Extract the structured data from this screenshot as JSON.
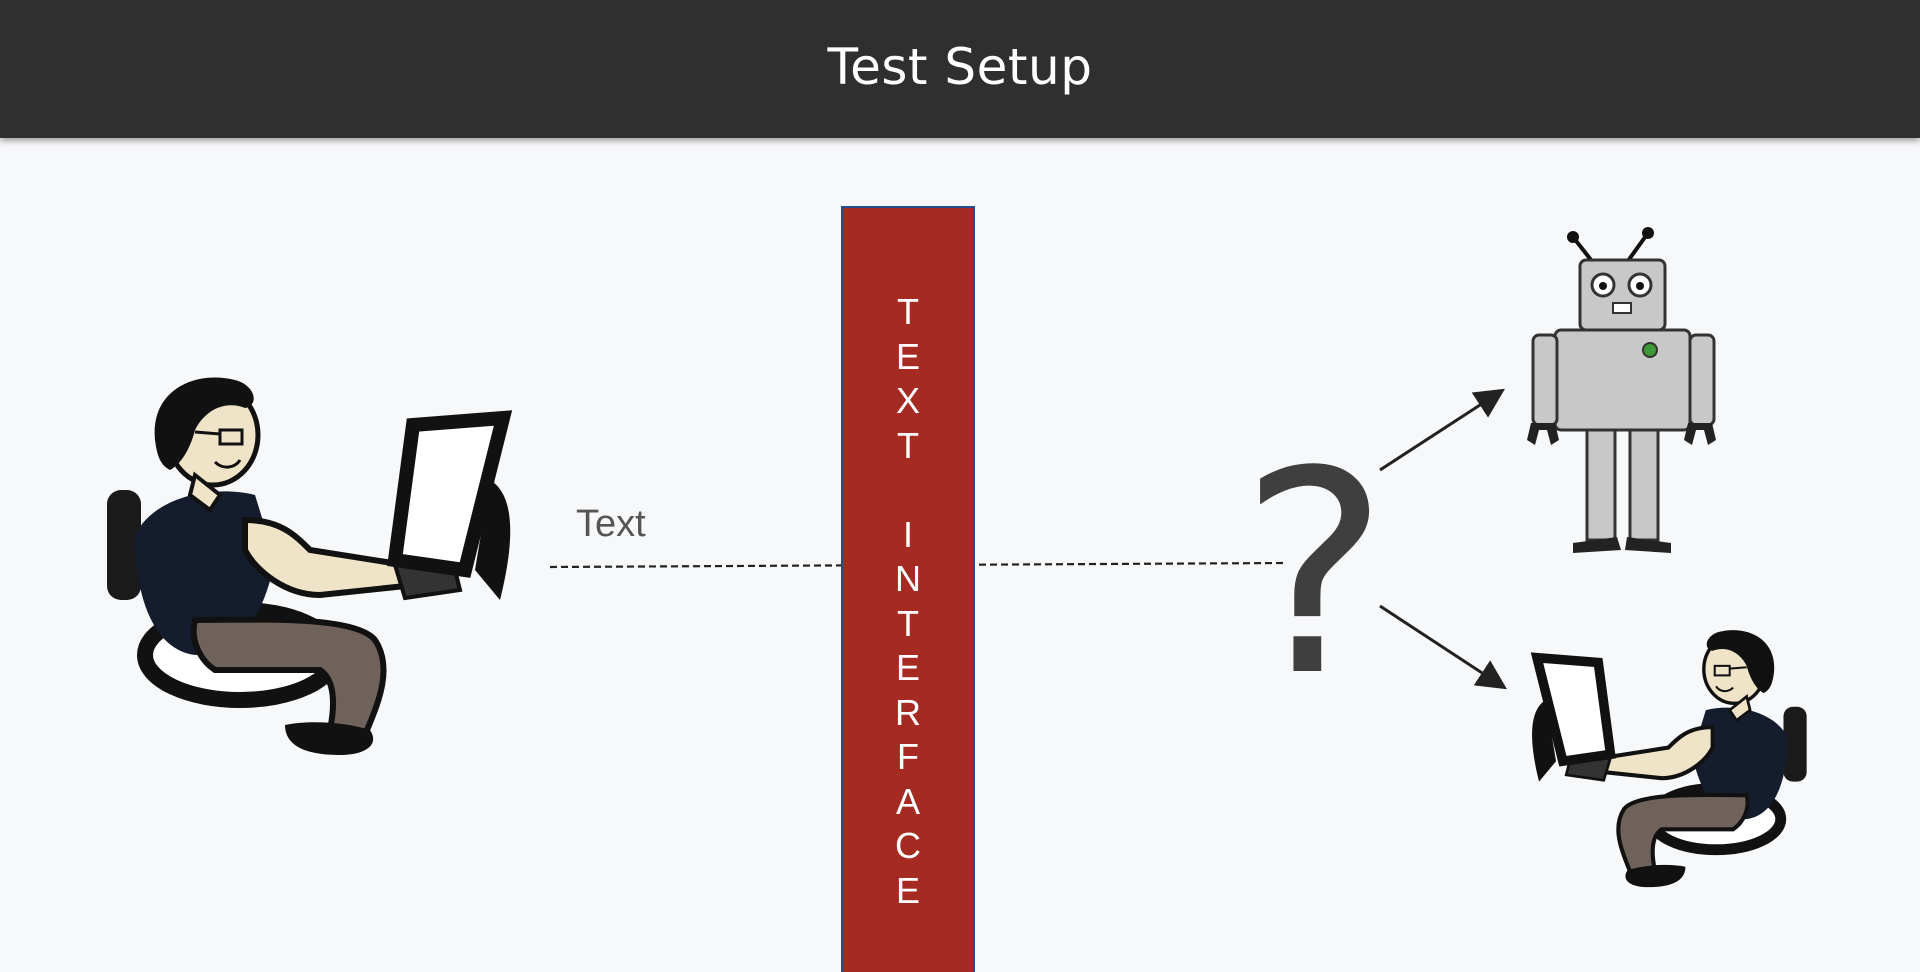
{
  "slide": {
    "title": "Test Setup",
    "text_label": "Text",
    "question_mark": "?",
    "interface_letters": [
      "T",
      "E",
      "X",
      "T",
      "",
      "I",
      "N",
      "T",
      "E",
      "R",
      "F",
      "A",
      "C",
      "E"
    ]
  },
  "colors": {
    "title_bar": "#2f2f2f",
    "interface_bar": "#a52a21",
    "question_mark": "#3f3f3f",
    "shirt": "#141c2e",
    "pants": "#6f625a",
    "robot": "#c8c8c8"
  },
  "icons": {
    "left_figure": "person-at-computer-icon",
    "robot": "robot-icon",
    "right_figure": "person-at-computer-icon"
  }
}
